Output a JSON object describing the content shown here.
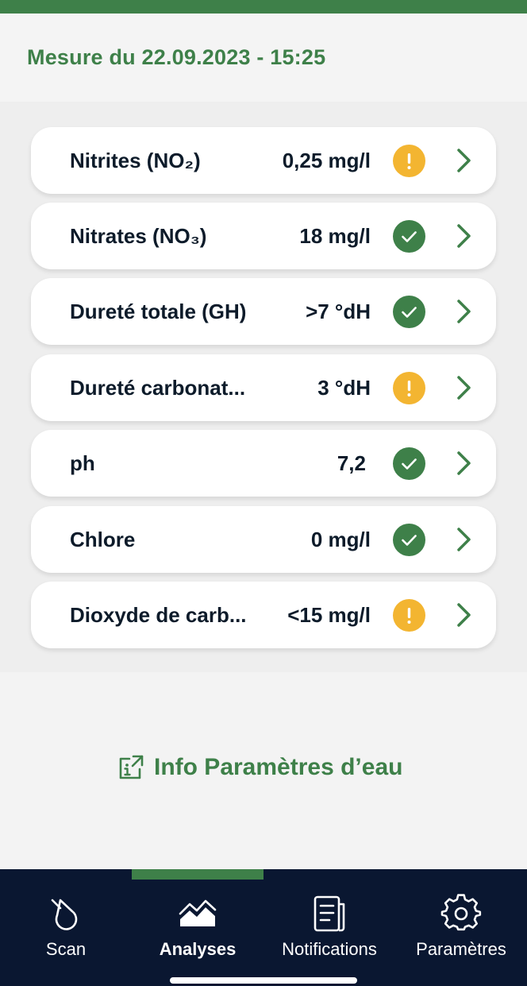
{
  "header": {
    "title": "Mesure du 22.09.2023 - 15:25"
  },
  "colors": {
    "brand_green": "#3e8049",
    "warning": "#f3b531",
    "ok": "#3e8049",
    "navbar": "#0a1731"
  },
  "measurements": [
    {
      "name": "Nitrites (NO₂)",
      "value": "0,25 mg/l",
      "status": "warning",
      "status_icon": "exclamation-icon"
    },
    {
      "name": "Nitrates (NO₃)",
      "value": "18 mg/l",
      "status": "ok",
      "status_icon": "check-icon"
    },
    {
      "name": "Dureté totale (GH)",
      "value": ">7 °dH",
      "status": "ok",
      "status_icon": "check-icon"
    },
    {
      "name": "Dureté carbonat...",
      "value": "3 °dH",
      "status": "warning",
      "status_icon": "exclamation-icon"
    },
    {
      "name": "ph",
      "value": "7,2",
      "status": "ok",
      "status_icon": "check-icon"
    },
    {
      "name": "Chlore",
      "value": "0 mg/l",
      "status": "ok",
      "status_icon": "check-icon"
    },
    {
      "name": "Dioxyde de carb...",
      "value": "<15 mg/l",
      "status": "warning",
      "status_icon": "exclamation-icon"
    }
  ],
  "info_link": {
    "label": "Info Paramètres d’eau",
    "icon": "external-info-icon"
  },
  "tabs": [
    {
      "label": "Scan",
      "icon": "scan-drop-icon",
      "active": false
    },
    {
      "label": "Analyses",
      "icon": "analyses-chart-icon",
      "active": true
    },
    {
      "label": "Notifications",
      "icon": "notifications-document-icon",
      "active": false
    },
    {
      "label": "Paramètres",
      "icon": "gear-icon",
      "active": false
    }
  ]
}
